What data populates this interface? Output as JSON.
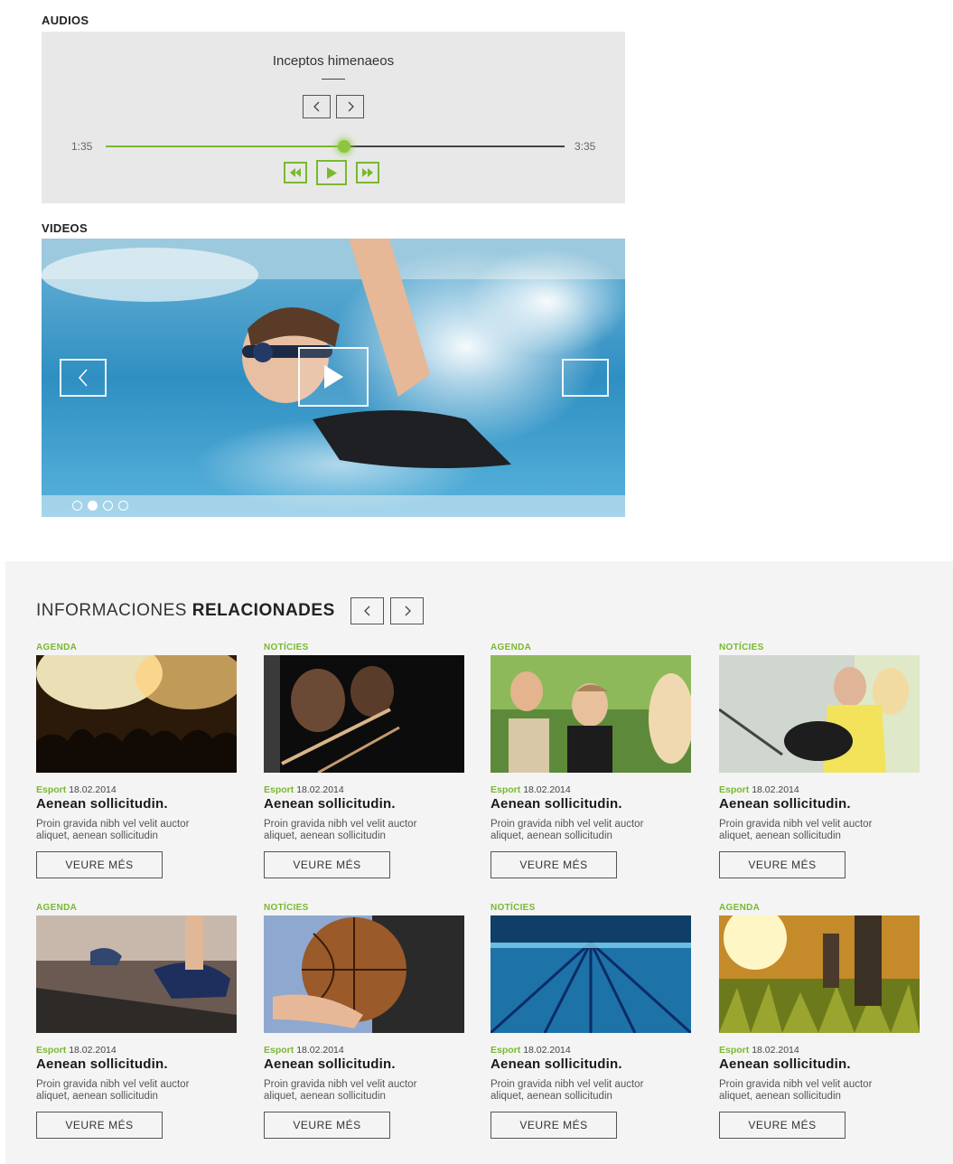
{
  "audios": {
    "section_label": "AUDIOS",
    "track_title": "Inceptos himenaeos",
    "time_current": "1:35",
    "time_total": "3:35",
    "progress": 0.52,
    "colors": {
      "accent": "#7ab830",
      "panel": "#e8e8e8"
    }
  },
  "videos": {
    "section_label": "VIDEOS",
    "slide_count": 4,
    "active_slide": 1
  },
  "related": {
    "title_light": "INFORMACIONES",
    "title_bold": "RELACIONADES",
    "cards": [
      {
        "category": "AGENDA",
        "tag": "Esport",
        "date": "18.02.2014",
        "headline": "Aenean sollicitudin.",
        "line1": "Proin gravida nibh vel velit auctor",
        "line2": "aliquet, aenean sollicitudin",
        "button": "VEURE MÉS",
        "image": "concert-crowd"
      },
      {
        "category": "NOTÍCIES",
        "tag": "Esport",
        "date": "18.02.2014",
        "headline": "Aenean sollicitudin.",
        "line1": "Proin gravida nibh vel velit auctor",
        "line2": "aliquet, aenean sollicitudin",
        "button": "VEURE MÉS",
        "image": "violinists"
      },
      {
        "category": "AGENDA",
        "tag": "Esport",
        "date": "18.02.2014",
        "headline": "Aenean sollicitudin.",
        "line1": "Proin gravida nibh vel velit auctor",
        "line2": "aliquet, aenean sollicitudin",
        "button": "VEURE MÉS",
        "image": "friends-guitar"
      },
      {
        "category": "NOTÍCIES",
        "tag": "Esport",
        "date": "18.02.2014",
        "headline": "Aenean sollicitudin.",
        "line1": "Proin gravida nibh vel velit auctor",
        "line2": "aliquet, aenean sollicitudin",
        "button": "VEURE MÉS",
        "image": "girls-guitar"
      },
      {
        "category": "AGENDA",
        "tag": "Esport",
        "date": "18.02.2014",
        "headline": "Aenean sollicitudin.",
        "line1": "Proin gravida nibh vel velit auctor",
        "line2": "aliquet, aenean sollicitudin",
        "button": "VEURE MÉS",
        "image": "treadmill"
      },
      {
        "category": "NOTÍCIES",
        "tag": "Esport",
        "date": "18.02.2014",
        "headline": "Aenean sollicitudin.",
        "line1": "Proin gravida nibh vel velit auctor",
        "line2": "aliquet, aenean sollicitudin",
        "button": "VEURE MÉS",
        "image": "basketball"
      },
      {
        "category": "NOTÍCIES",
        "tag": "Esport",
        "date": "18.02.2014",
        "headline": "Aenean sollicitudin.",
        "line1": "Proin gravida nibh vel velit auctor",
        "line2": "aliquet, aenean sollicitudin",
        "button": "VEURE MÉS",
        "image": "swimming-pool"
      },
      {
        "category": "AGENDA",
        "tag": "Esport",
        "date": "18.02.2014",
        "headline": "Aenean sollicitudin.",
        "line1": "Proin gravida nibh vel velit auctor",
        "line2": "aliquet, aenean sollicitudin",
        "button": "VEURE MÉS",
        "image": "hikers-field"
      }
    ]
  }
}
